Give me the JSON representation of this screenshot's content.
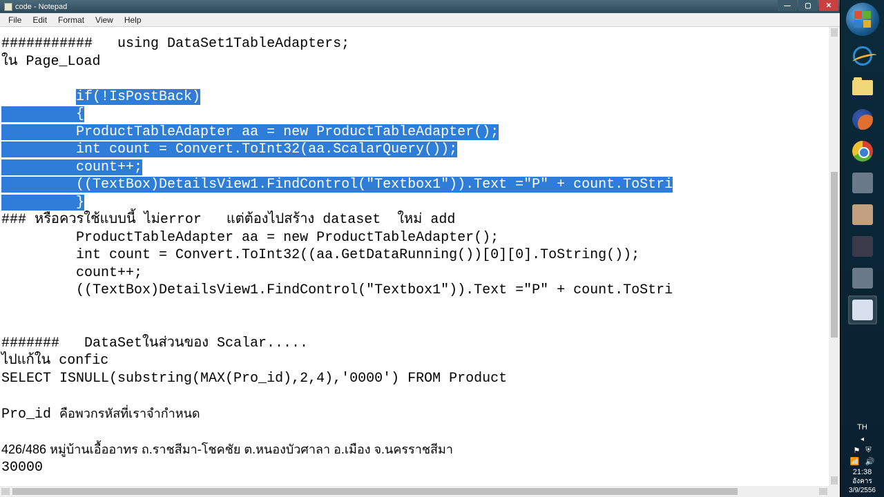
{
  "window": {
    "title": "code - Notepad"
  },
  "menu": {
    "file": "File",
    "edit": "Edit",
    "format": "Format",
    "view": "View",
    "help": "Help"
  },
  "code": {
    "l1a": "###########   using DataSet1TableAdapters;",
    "l2": "ใน Page_Load",
    "l3": "",
    "s1": "if(!IsPostBack)",
    "s2_indent": "         ",
    "s2": "{",
    "s3": "ProductTableAdapter aa = new ProductTableAdapter();",
    "s4": "int count = Convert.ToInt32(aa.ScalarQuery());",
    "s5": "count++;",
    "s6": "((TextBox)DetailsView1.FindControl(\"Textbox1\")).Text =\"P\" + count.ToStri",
    "s7": "}",
    "l4a": "### หรือควรใช้แบบนี้ ไม่error   แต่ต้องไปสร้าง dataset  ใหม่ add",
    "l5": "         ProductTableAdapter aa = new ProductTableAdapter();",
    "l6": "         int count = Convert.ToInt32((aa.GetDataRunning())[0][0].ToString());",
    "l7": "         count++;",
    "l8": "         ((TextBox)DetailsView1.FindControl(\"Textbox1\")).Text =\"P\" + count.ToStri",
    "l9": "",
    "l10": "",
    "l11": "#######   DataSetในส่วนของ Scalar.....",
    "l12": "ไปแก้ใน confic",
    "l13": "SELECT ISNULL(substring(MAX(Pro_id),2,4),'0000') FROM Product",
    "l14": "",
    "l15a": "Pro_id ",
    "l15b": "คือพวกรหัสที่เราจำกำหนด",
    "l16": "",
    "l17": "426/486 หมู่บ้านเอื้ออาทร ถ.ราชสีมา-โชคชัย ต.หนองบัวศาลา อ.เมือง จ.นครราชสีมา",
    "l18": "30000"
  },
  "tray": {
    "lang": "TH",
    "time": "21:38",
    "day": "อังคาร",
    "date": "3/9/2556"
  }
}
